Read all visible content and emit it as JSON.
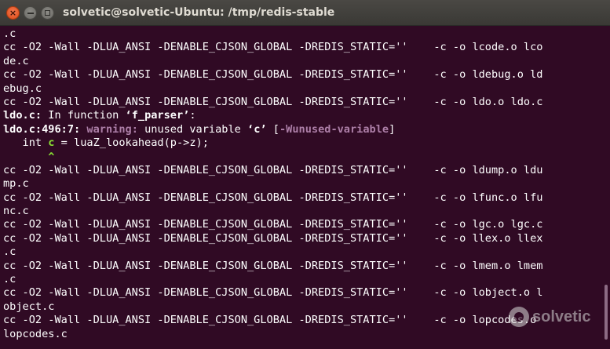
{
  "window": {
    "title": "solvetic@solvetic-Ubuntu: /tmp/redis-stable"
  },
  "terminal": {
    "lines": [
      [
        {
          "t": ".c"
        }
      ],
      [
        {
          "t": "cc -O2 -Wall -DLUA_ANSI -DENABLE_CJSON_GLOBAL -DREDIS_STATIC=''    -c -o lcode.o lco"
        }
      ],
      [
        {
          "t": "de.c"
        }
      ],
      [
        {
          "t": "cc -O2 -Wall -DLUA_ANSI -DENABLE_CJSON_GLOBAL -DREDIS_STATIC=''    -c -o ldebug.o ld"
        }
      ],
      [
        {
          "t": "ebug.c"
        }
      ],
      [
        {
          "t": "cc -O2 -Wall -DLUA_ANSI -DENABLE_CJSON_GLOBAL -DREDIS_STATIC=''    -c -o ldo.o ldo.c"
        }
      ],
      [
        {
          "t": "ldo.c:",
          "s": "b"
        },
        {
          "t": " In function "
        },
        {
          "t": "‘f_parser’",
          "s": "b"
        },
        {
          "t": ":"
        }
      ],
      [
        {
          "t": "ldo.c:496:7:",
          "s": "b"
        },
        {
          "t": " "
        },
        {
          "t": "warning:",
          "s": "warn"
        },
        {
          "t": " unused variable "
        },
        {
          "t": "‘c’",
          "s": "b"
        },
        {
          "t": " ["
        },
        {
          "t": "-Wunused-variable",
          "s": "flag"
        },
        {
          "t": "]"
        }
      ],
      [
        {
          "t": "   int "
        },
        {
          "t": "c",
          "s": "caret"
        },
        {
          "t": " = luaZ_lookahead(p->z);"
        }
      ],
      [
        {
          "t": "       "
        },
        {
          "t": "^",
          "s": "caret"
        }
      ],
      [
        {
          "t": "cc -O2 -Wall -DLUA_ANSI -DENABLE_CJSON_GLOBAL -DREDIS_STATIC=''    -c -o ldump.o ldu"
        }
      ],
      [
        {
          "t": "mp.c"
        }
      ],
      [
        {
          "t": "cc -O2 -Wall -DLUA_ANSI -DENABLE_CJSON_GLOBAL -DREDIS_STATIC=''    -c -o lfunc.o lfu"
        }
      ],
      [
        {
          "t": "nc.c"
        }
      ],
      [
        {
          "t": "cc -O2 -Wall -DLUA_ANSI -DENABLE_CJSON_GLOBAL -DREDIS_STATIC=''    -c -o lgc.o lgc.c"
        }
      ],
      [
        {
          "t": "cc -O2 -Wall -DLUA_ANSI -DENABLE_CJSON_GLOBAL -DREDIS_STATIC=''    -c -o llex.o llex"
        }
      ],
      [
        {
          "t": ".c"
        }
      ],
      [
        {
          "t": "cc -O2 -Wall -DLUA_ANSI -DENABLE_CJSON_GLOBAL -DREDIS_STATIC=''    -c -o lmem.o lmem"
        }
      ],
      [
        {
          "t": ".c"
        }
      ],
      [
        {
          "t": "cc -O2 -Wall -DLUA_ANSI -DENABLE_CJSON_GLOBAL -DREDIS_STATIC=''    -c -o lobject.o l"
        }
      ],
      [
        {
          "t": "object.c"
        }
      ],
      [
        {
          "t": "cc -O2 -Wall -DLUA_ANSI -DENABLE_CJSON_GLOBAL -DREDIS_STATIC=''    -c -o lopcodes.o"
        }
      ],
      [
        {
          "t": "lopcodes.c"
        }
      ]
    ]
  },
  "watermark": {
    "text": "solvetic"
  },
  "colors": {
    "terminal_bg": "#300a24",
    "titlebar_bg": "#3c3b37",
    "warning": "#ad7fa8",
    "caret": "#8ae234",
    "close_button": "#dd4814"
  },
  "icons": {
    "close": "close-icon",
    "minimize": "minimize-icon",
    "maximize": "maximize-icon"
  }
}
